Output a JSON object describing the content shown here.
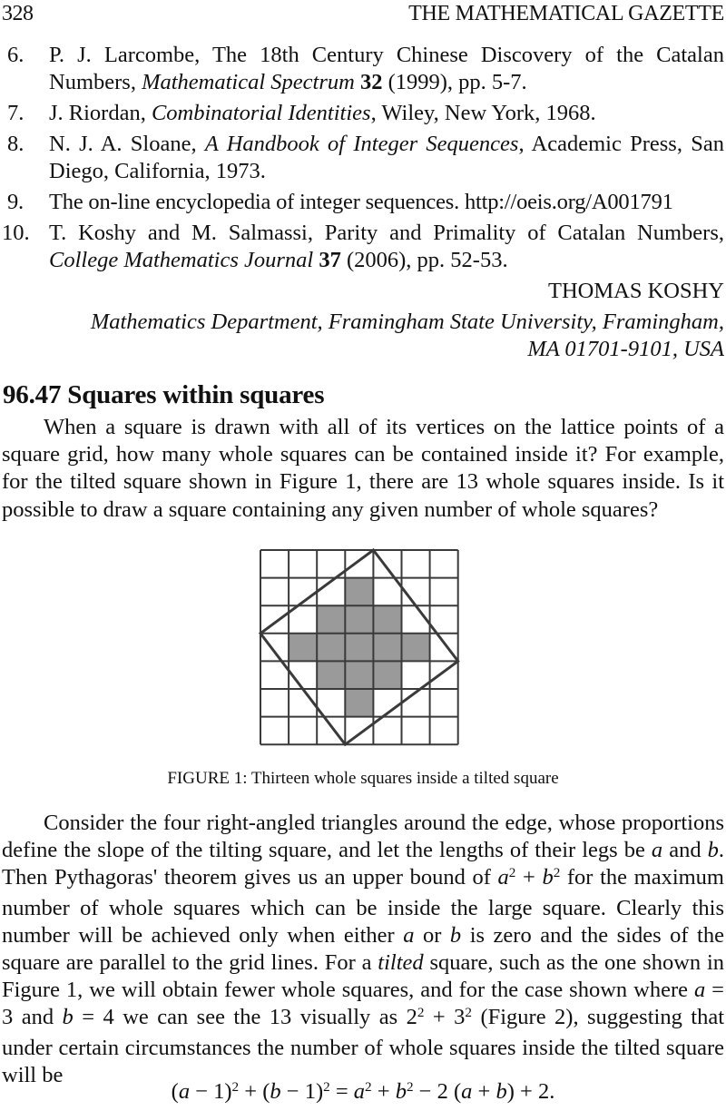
{
  "header": {
    "page_number": "328",
    "journal_title": "THE MATHEMATICAL GAZETTE"
  },
  "references": [
    {
      "number": "6.",
      "parts": [
        {
          "text": "P. J. Larcombe, The 18th Century Chinese Discovery of the Catalan Numbers, ",
          "style": "normal"
        },
        {
          "text": "Mathematical Spectrum",
          "style": "italic"
        },
        {
          "text": " ",
          "style": "normal"
        },
        {
          "text": "32",
          "style": "bold"
        },
        {
          "text": " (1999), pp. 5-7.",
          "style": "normal"
        }
      ]
    },
    {
      "number": "7.",
      "parts": [
        {
          "text": "J. Riordan, ",
          "style": "normal"
        },
        {
          "text": "Combinatorial Identities",
          "style": "italic"
        },
        {
          "text": ", Wiley, New York, 1968.",
          "style": "normal"
        }
      ]
    },
    {
      "number": "8.",
      "parts": [
        {
          "text": "N. J. A. Sloane, ",
          "style": "normal"
        },
        {
          "text": "A Handbook of Integer Sequences",
          "style": "italic"
        },
        {
          "text": ", Academic Press, San Diego, California, 1973.",
          "style": "normal"
        }
      ]
    },
    {
      "number": "9.",
      "parts": [
        {
          "text": "The on-line encyclopedia of integer sequences. http://oeis.org/A001791",
          "style": "normal"
        }
      ]
    },
    {
      "number": "10.",
      "parts": [
        {
          "text": "T. Koshy and M. Salmassi, Parity and Primality of Catalan Numbers, ",
          "style": "normal"
        },
        {
          "text": "College Mathematics Journal",
          "style": "italic"
        },
        {
          "text": " ",
          "style": "normal"
        },
        {
          "text": "37",
          "style": "bold"
        },
        {
          "text": " (2006), pp. 52-53.",
          "style": "normal"
        }
      ]
    }
  ],
  "author": {
    "name": "THOMAS KOSHY",
    "affiliation_line1": "Mathematics Department, Framingham State University, Framingham,",
    "affiliation_line2": "MA 01701-9101, USA"
  },
  "note": {
    "title": "96.47  Squares within squares",
    "intro_paragraph": "When a square is drawn with all of its vertices on the lattice points of a square grid, how many whole squares can be contained inside it? For example, for the tilted square shown in Figure 1, there are 13 whole squares inside. Is it possible to draw a square containing any given number of whole squares?",
    "figure": {
      "caption": "FIGURE 1: Thirteen whole squares inside a tilted square",
      "grid_size": 7,
      "tilted_square_vertices": [
        [
          4,
          0
        ],
        [
          7,
          4
        ],
        [
          3,
          7
        ],
        [
          0,
          3
        ]
      ],
      "shaded_cells": [
        [
          1,
          3
        ],
        [
          2,
          2
        ],
        [
          2,
          3
        ],
        [
          2,
          4
        ],
        [
          3,
          1
        ],
        [
          3,
          2
        ],
        [
          3,
          3
        ],
        [
          3,
          4
        ],
        [
          3,
          5
        ],
        [
          4,
          2
        ],
        [
          4,
          3
        ],
        [
          4,
          4
        ],
        [
          5,
          3
        ]
      ],
      "shade_color": "#9a9a9a",
      "line_color": "#3a3a3a"
    },
    "body_paragraph": [
      {
        "text": "Consider the four right-angled triangles around the edge, whose proportions define the slope of the tilting square, and let the lengths of their legs be ",
        "style": "normal"
      },
      {
        "text": "a",
        "style": "italic"
      },
      {
        "text": " and ",
        "style": "normal"
      },
      {
        "text": "b",
        "style": "italic"
      },
      {
        "text": ". Then Pythagoras' theorem gives us an upper bound of ",
        "style": "normal"
      },
      {
        "text": "a",
        "style": "italic"
      },
      {
        "text": "2",
        "style": "sup"
      },
      {
        "text": " + ",
        "style": "normal"
      },
      {
        "text": "b",
        "style": "italic"
      },
      {
        "text": "2",
        "style": "sup"
      },
      {
        "text": " for the maximum number of whole squares which can be inside the large square. Clearly this number will be achieved only when either ",
        "style": "normal"
      },
      {
        "text": "a",
        "style": "italic"
      },
      {
        "text": " or ",
        "style": "normal"
      },
      {
        "text": "b",
        "style": "italic"
      },
      {
        "text": " is zero and the sides of the square are parallel to the grid lines. For a ",
        "style": "normal"
      },
      {
        "text": "tilted",
        "style": "italic"
      },
      {
        "text": " square, such as the one shown in Figure 1, we will obtain fewer whole squares, and for the case shown where ",
        "style": "normal"
      },
      {
        "text": "a",
        "style": "italic"
      },
      {
        "text": " = 3 and ",
        "style": "normal"
      },
      {
        "text": "b",
        "style": "italic"
      },
      {
        "text": " = 4 we can see the 13 visually as 2",
        "style": "normal"
      },
      {
        "text": "2",
        "style": "sup"
      },
      {
        "text": " + 3",
        "style": "normal"
      },
      {
        "text": "2",
        "style": "sup"
      },
      {
        "text": " (Figure 2), suggesting that under certain circumstances the number of whole squares inside the tilted square will be",
        "style": "normal"
      }
    ],
    "equation": [
      {
        "text": "(",
        "style": "normal"
      },
      {
        "text": "a",
        "style": "italic"
      },
      {
        "text": " − 1)",
        "style": "normal"
      },
      {
        "text": "2",
        "style": "sup"
      },
      {
        "text": " + (",
        "style": "normal"
      },
      {
        "text": "b",
        "style": "italic"
      },
      {
        "text": " − 1)",
        "style": "normal"
      },
      {
        "text": "2",
        "style": "sup"
      },
      {
        "text": " = ",
        "style": "normal"
      },
      {
        "text": "a",
        "style": "italic"
      },
      {
        "text": "2",
        "style": "sup"
      },
      {
        "text": " + ",
        "style": "normal"
      },
      {
        "text": "b",
        "style": "italic"
      },
      {
        "text": "2",
        "style": "sup"
      },
      {
        "text": " − 2 (",
        "style": "normal"
      },
      {
        "text": "a",
        "style": "italic"
      },
      {
        "text": " + ",
        "style": "normal"
      },
      {
        "text": "b",
        "style": "italic"
      },
      {
        "text": ") + 2.",
        "style": "normal"
      }
    ]
  }
}
